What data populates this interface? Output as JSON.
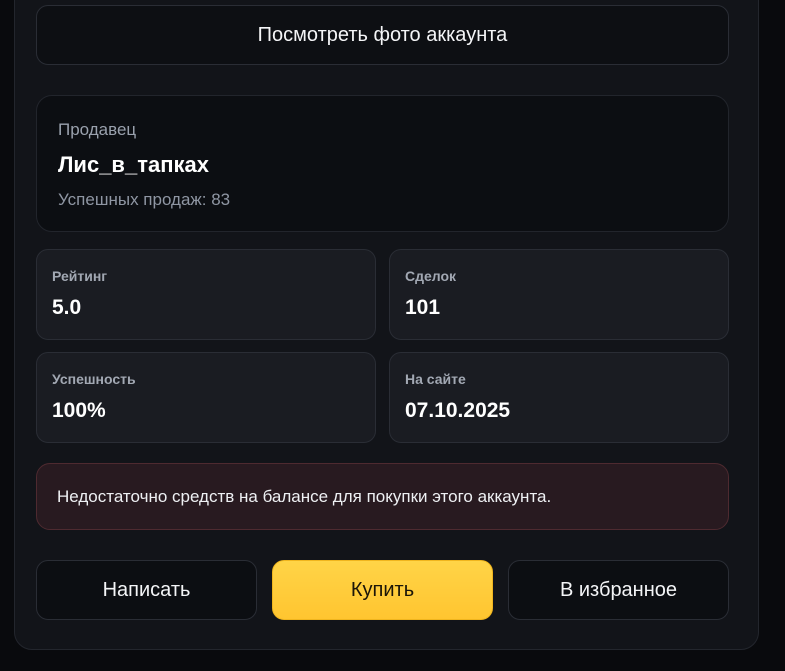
{
  "photo_button": {
    "label": "Посмотреть фото аккаунта"
  },
  "seller": {
    "label": "Продавец",
    "name": "Лис_в_тапках",
    "sales": "Успешных продаж: 83"
  },
  "stats": [
    {
      "label": "Рейтинг",
      "value": "5.0"
    },
    {
      "label": "Сделок",
      "value": "101"
    },
    {
      "label": "Успешность",
      "value": "100%"
    },
    {
      "label": "На сайте",
      "value": "07.10.2025"
    }
  ],
  "alert": {
    "message": "Недостаточно средств на балансе для покупки этого аккаунта."
  },
  "actions": {
    "message": "Написать",
    "buy": "Купить",
    "favorite": "В избранное"
  },
  "colors": {
    "accent": "#ffc530",
    "alert_bg": "#281a20",
    "alert_border": "#4e2a30",
    "panel_bg": "#121419"
  }
}
